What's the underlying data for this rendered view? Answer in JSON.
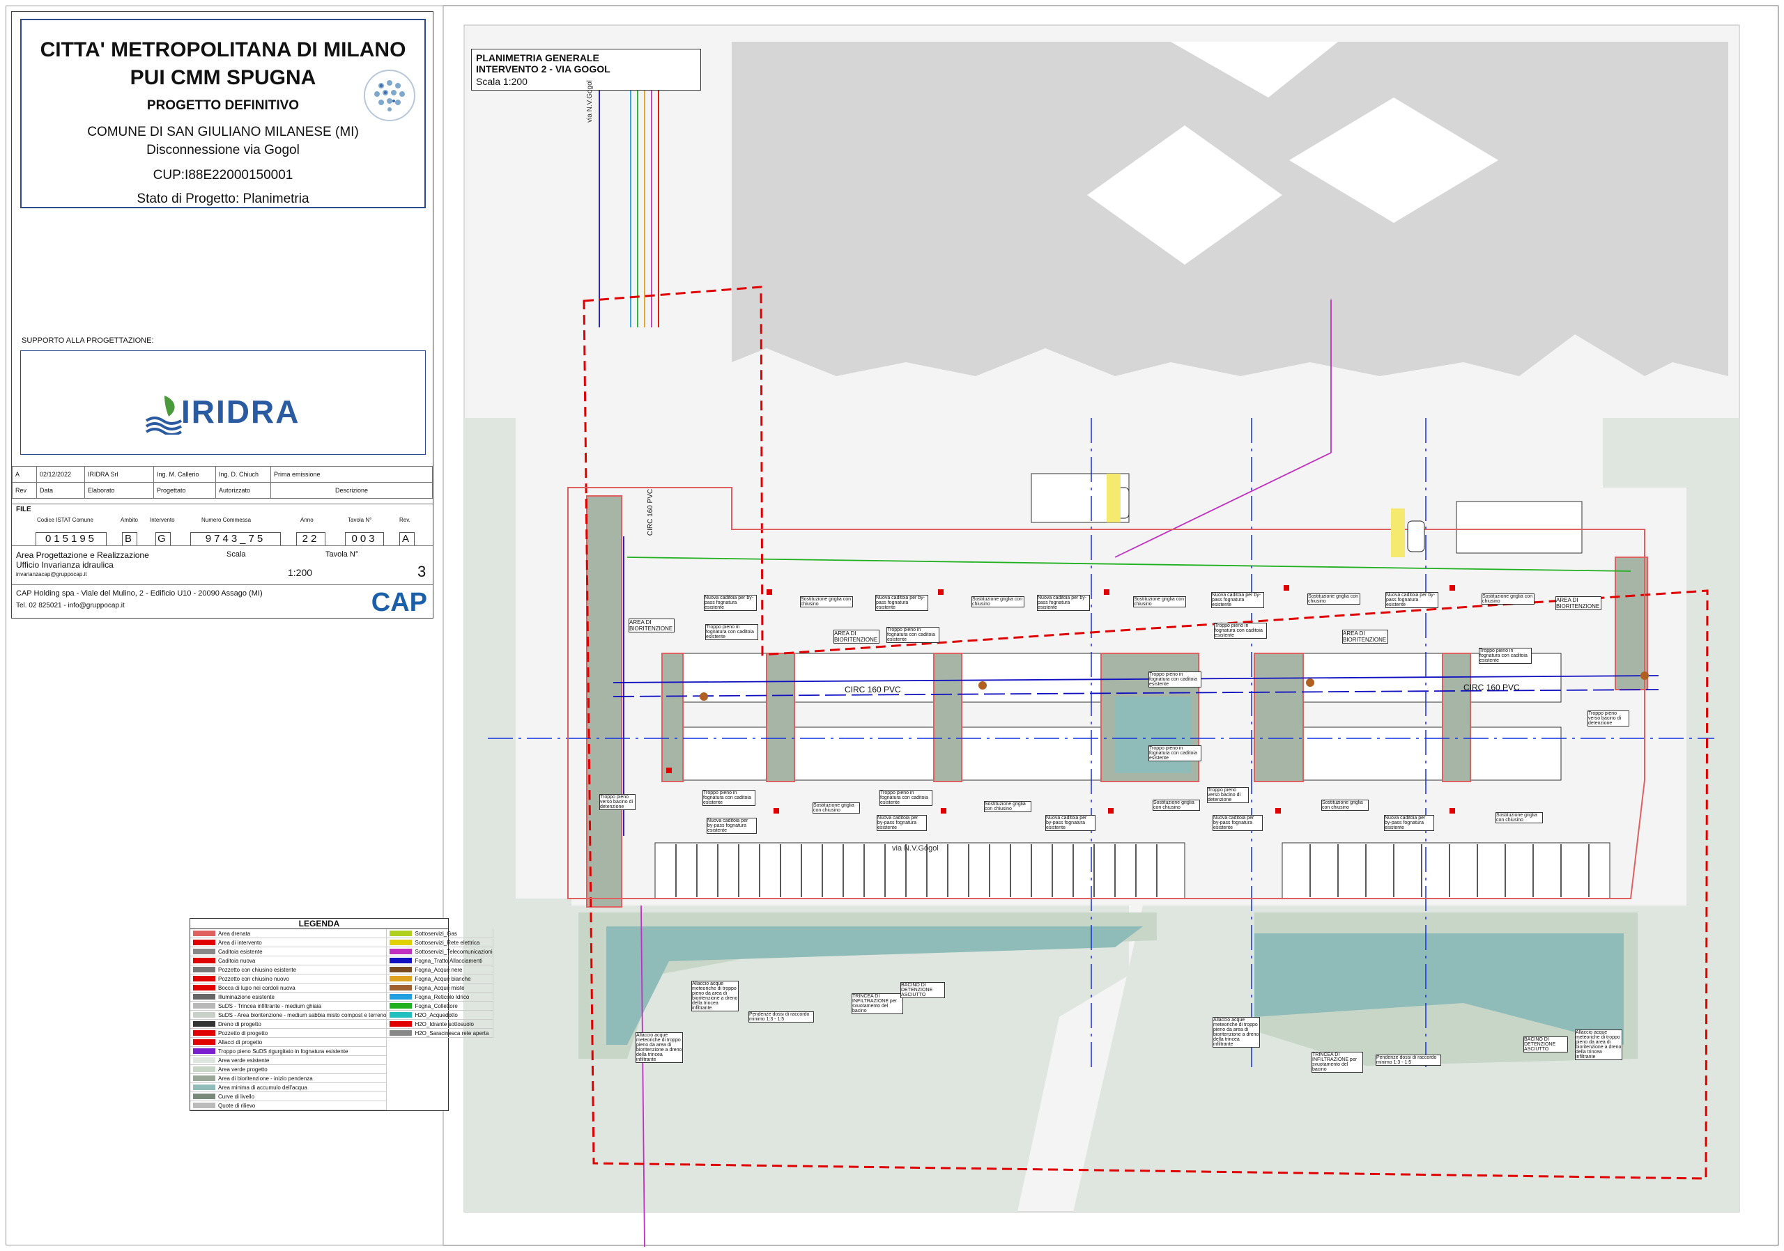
{
  "title_block": {
    "title1": "CITTA' METROPOLITANA DI MILANO",
    "title2": "PUI CMM SPUGNA",
    "subtitle": "PROGETTO DEFINITIVO",
    "comune": "COMUNE DI SAN GIULIANO MILANESE (MI)",
    "intervento": "Disconnessione via Gogol",
    "cup": "CUP:I88E22000150001",
    "stato": "Stato di Progetto: Planimetria",
    "support_label": "SUPPORTO ALLA PROGETTAZIONE:",
    "support_logo": "IRIDRA",
    "revision": {
      "rev": "A",
      "date": "02/12/2022",
      "elaborato": "IRIDRA Srl",
      "progettato": "Ing. M. Callerio",
      "autorizzato": "Ing. D. Chiuch",
      "descrizione": "Prima emissione",
      "headers": [
        "Rev",
        "Data",
        "Elaborato",
        "Progettato",
        "Autorizzato",
        "Descrizione"
      ]
    },
    "file_label": "FILE",
    "codes": {
      "istat_label": "Codice ISTAT Comune",
      "istat": "015195",
      "ambito_label": "Ambito",
      "ambito": "B",
      "intervento_label": "Intervento",
      "intervento": "G",
      "commessa_label": "Numero Commessa",
      "commessa": "9743_75",
      "anno_label": "Anno",
      "anno": "22",
      "tavola_label": "Tavola N°",
      "tavola": "003",
      "rev_label": "Rev.",
      "rev": "A"
    },
    "area": {
      "line1": "Area Progettazione e Realizzazione",
      "line2": "Ufficio Invarianza idraulica",
      "email": "invarianzacap@gruppocap.it",
      "scala_label": "Scala",
      "scala": "1:200",
      "tavola_label": "Tavola N°",
      "tavola": "3"
    },
    "cap": {
      "line1": "CAP Holding spa - Viale del Mulino, 2 - Edificio U10 - 20090 Assago (MI)",
      "line2": "Tel. 02 825021 - info@gruppocap.it",
      "logo": "CAP"
    }
  },
  "plan_title": {
    "line1": "PLANIMETRIA GENERALE",
    "line2": "INTERVENTO 2 - VIA GOGOL",
    "line3": "Scala 1:200"
  },
  "map_labels": {
    "street1": "via N.V.Gogol",
    "street2": "via N.V.Gogol",
    "pipe1": "CIRC 160 PVC",
    "pipe2": "CIRC 160 PVC",
    "pipe3": "CIRC 160 PVC",
    "bioretention1": "AREA DI BIORITENZIONE",
    "bioretention2": "AREA DI BIORITENZIONE",
    "bioretention3": "AREA DI BIORITENZIONE",
    "bioretention4": "AREA DI BIORITENZIONE",
    "callout_new_grate": "Nuova caditoia per by-pass fognatura esistente",
    "callout_replace": "Sostituzione griglia con chiusino",
    "callout_overflow": "Troppo pieno in fognatura con caditoia esistente",
    "callout_overflow_basin": "Troppo pieno verso bacino di detenzione",
    "callout_connection": "Allaccio acque meteoriche di troppo pieno da area di bioritenzione a dreno della trincea infiltrante",
    "callout_slope": "Pendenze dossi di raccordo minimo 1:3 - 1:5",
    "callout_trench": "TRINCEA DI INFILTRAZIONE per svuotamento del bacino",
    "callout_basin": "BACINO DI DETENZIONE ASCIUTTO"
  },
  "legend": {
    "title": "LEGENDA",
    "left": [
      {
        "label": "Area drenata",
        "color": "#e06060"
      },
      {
        "label": "Area di intervento",
        "color": "#e00000"
      },
      {
        "label": "Caditoia esistente",
        "color": "#888888"
      },
      {
        "label": "Caditoia nuova",
        "color": "#e00000"
      },
      {
        "label": "Pozzetto con chiusino esistente",
        "color": "#777777"
      },
      {
        "label": "Pozzetto con chiusino nuovo",
        "color": "#e00000"
      },
      {
        "label": "Bocca di lupo nei cordoli nuova",
        "color": "#e00000"
      },
      {
        "label": "Illuminazione esistente",
        "color": "#666666"
      },
      {
        "label": "SuDS - Trincea infiltrante - medium ghiaia",
        "color": "#b8b8b8"
      },
      {
        "label": "SuDS - Area bioritenzione - medium sabbia misto compost e terreno",
        "color": "#c8d0c8"
      },
      {
        "label": "Dreno di progetto",
        "color": "#333333"
      },
      {
        "label": "Pozzetto di progetto",
        "color": "#e00000"
      },
      {
        "label": "Allacci di progetto",
        "color": "#e00000"
      },
      {
        "label": "Troppo pieno SuDS rigurgitato in fognatura esistente",
        "color": "#7a1fd0"
      },
      {
        "label": "Area verde esistente",
        "color": "#dfe6df"
      },
      {
        "label": "Area verde progetto",
        "color": "#c8d6c8"
      },
      {
        "label": "Area di bioritenzione - inizio pendenza",
        "color": "#9aa89a"
      },
      {
        "label": "Area minima di accumulo dell'acqua",
        "color": "#8fbcb8"
      },
      {
        "label": "Curve di livello",
        "color": "#7a8a7a"
      },
      {
        "label": "Quote di rilievo",
        "color": "#bbbbbb"
      }
    ],
    "right": [
      {
        "label": "Sottoservizi_Gas",
        "color": "#b0d020"
      },
      {
        "label": "Sottoservizi_Rete elettrica",
        "color": "#e0d000"
      },
      {
        "label": "Sottoservizi_Telecomunicazioni",
        "color": "#c030c0"
      },
      {
        "label": "Fogna_Tratto Allacciamenti",
        "color": "#1010c0"
      },
      {
        "label": "Fogna_Acque nere",
        "color": "#7a4a20"
      },
      {
        "label": "Fogna_Acque bianche",
        "color": "#e0a020"
      },
      {
        "label": "Fogna_Acque miste",
        "color": "#a06030"
      },
      {
        "label": "Fogna_Reticolo Idrico",
        "color": "#20a0e0"
      },
      {
        "label": "Fogna_Collettore",
        "color": "#20b020"
      },
      {
        "label": "H2O_Acquedotto",
        "color": "#20c0c0"
      },
      {
        "label": "H2O_Idrante sottosuolo",
        "color": "#e00000"
      },
      {
        "label": "H2O_Saracinesca rete aperta",
        "color": "#888888"
      }
    ]
  }
}
